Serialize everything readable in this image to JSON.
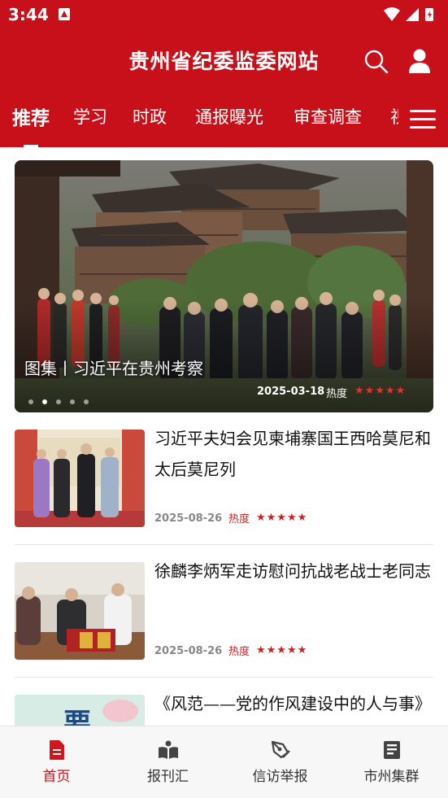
{
  "status_bar": {
    "time": "3:44"
  },
  "header": {
    "title": "贵州省纪委监委网站"
  },
  "tabs": [
    {
      "label": "推荐",
      "active": true
    },
    {
      "label": "学习",
      "active": false
    },
    {
      "label": "时政",
      "active": false
    },
    {
      "label": "通报曝光",
      "active": false
    },
    {
      "label": "审查调查",
      "active": false
    },
    {
      "label": "视",
      "active": false
    }
  ],
  "banner": {
    "caption": "图集丨习近平在贵州考察",
    "date": "2025-03-18",
    "heat_label": "热度",
    "stars": "★★★★★",
    "rating": 5,
    "page_count": 5,
    "active_page": 1
  },
  "news": [
    {
      "title": "习近平夫妇会见柬埔寨国王西哈莫尼和太后莫尼列",
      "date": "2025-08-26",
      "heat_label": "热度",
      "stars": "★★★★★",
      "rating": 5
    },
    {
      "title": "徐麟李炳军走访慰问抗战老战士老同志",
      "date": "2025-08-26",
      "heat_label": "热度",
      "stars": "★★★★★",
      "rating": 5
    },
    {
      "title": "《风范——党的作风建设中的人与事》专版发行",
      "thumb_text": "要",
      "date": "",
      "heat_label": "",
      "stars": ""
    }
  ],
  "bottom_nav": [
    {
      "label": "首页",
      "icon": "document-icon",
      "active": true
    },
    {
      "label": "报刊汇",
      "icon": "open-book-icon",
      "active": false
    },
    {
      "label": "信访举报",
      "icon": "pen-report-icon",
      "active": false
    },
    {
      "label": "市州集群",
      "icon": "newspaper-icon",
      "active": false
    }
  ],
  "colors": {
    "brand_red": "#c8101a",
    "star_red": "#d21d1d",
    "meta_gray": "#888888"
  }
}
